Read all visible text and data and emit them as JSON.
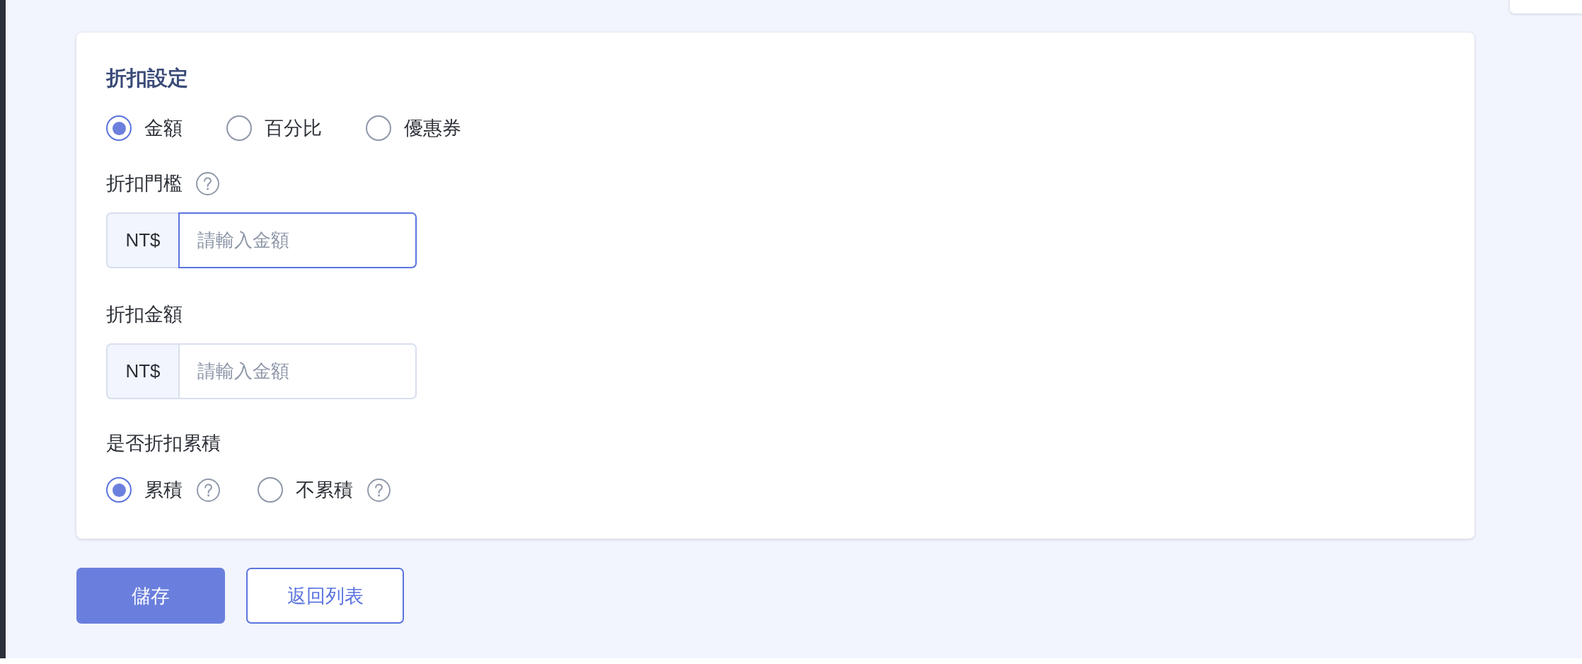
{
  "discount_settings": {
    "title": "折扣設定",
    "discount_types": [
      {
        "label": "金額",
        "selected": true
      },
      {
        "label": "百分比",
        "selected": false
      },
      {
        "label": "優惠券",
        "selected": false
      }
    ],
    "fields": [
      {
        "label": "折扣門檻",
        "help": true,
        "prefix": "NT$",
        "placeholder": "請輸入金額",
        "focused": true
      },
      {
        "label": "折扣金額",
        "help": false,
        "prefix": "NT$",
        "placeholder": "請輸入金額",
        "focused": false
      }
    ],
    "stacking": {
      "label": "是否折扣累積",
      "options": [
        {
          "label": "累積",
          "selected": true,
          "help": true
        },
        {
          "label": "不累積",
          "selected": false,
          "help": true
        }
      ]
    }
  },
  "buttons": [
    {
      "label": "儲存",
      "kind": "primary"
    },
    {
      "label": "返回列表",
      "kind": "secondary"
    }
  ]
}
